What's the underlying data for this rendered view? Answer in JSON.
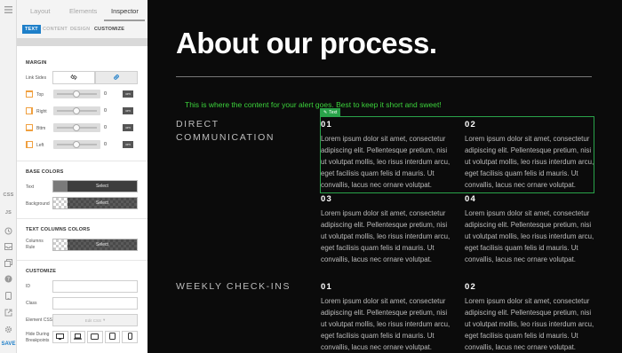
{
  "panel": {
    "tabs": [
      "Layout",
      "Elements",
      "Inspector"
    ],
    "subtabs": [
      "TEXT",
      "CONTENT",
      "DESIGN",
      "CUSTOMIZE"
    ],
    "margin": {
      "title": "MARGIN",
      "link_sides_label": "Link Sides",
      "sides": [
        {
          "label": "Top",
          "value": "0",
          "unit": "cm"
        },
        {
          "label": "Right",
          "value": "0",
          "unit": "cm"
        },
        {
          "label": "Bttm",
          "value": "0",
          "unit": "cm"
        },
        {
          "label": "Left",
          "value": "0",
          "unit": "cm"
        }
      ]
    },
    "base_colors": {
      "title": "BASE COLORS",
      "text_label": "Text",
      "background_label": "Background",
      "select_label": "Select"
    },
    "text_columns_colors": {
      "title": "TEXT COLUMNS COLORS",
      "columns_rule_label": "Columns Rule",
      "select_label": "Select"
    },
    "customize": {
      "title": "CUSTOMIZE",
      "id_label": "ID",
      "class_label": "Class",
      "element_css_label": "Element CSS",
      "element_css_button": "Edit CSS",
      "hide_label": "Hide During Breakpoints"
    }
  },
  "rail": {
    "css_label": "CSS",
    "js_label": "JS",
    "save_label": "SAVE"
  },
  "canvas": {
    "heading": "About our process.",
    "alert": "This is where the content for your alert goes. Best to keep it short and sweet!",
    "selection_tag": "Text",
    "rows": [
      {
        "title": "DIRECT COMMUNICATION",
        "items": [
          {
            "number": "01",
            "text": "Lorem ipsum dolor sit amet, consectetur adipiscing elit. Pellentesque pretium, nisi ut volutpat mollis, leo risus interdum arcu, eget facilisis quam felis id mauris. Ut convallis, lacus nec ornare volutpat."
          },
          {
            "number": "02",
            "text": "Lorem ipsum dolor sit amet, consectetur adipiscing elit. Pellentesque pretium, nisi ut volutpat mollis, leo risus interdum arcu, eget facilisis quam felis id mauris. Ut convallis, lacus nec ornare volutpat."
          },
          {
            "number": "03",
            "text": "Lorem ipsum dolor sit amet, consectetur adipiscing elit. Pellentesque pretium, nisi ut volutpat mollis, leo risus interdum arcu, eget facilisis quam felis id mauris. Ut convallis, lacus nec ornare volutpat."
          },
          {
            "number": "04",
            "text": "Lorem ipsum dolor sit amet, consectetur adipiscing elit. Pellentesque pretium, nisi ut volutpat mollis, leo risus interdum arcu, eget facilisis quam felis id mauris. Ut convallis, lacus nec ornare volutpat."
          }
        ]
      },
      {
        "title": "WEEKLY CHECK-INS",
        "items": [
          {
            "number": "01",
            "text": "Lorem ipsum dolor sit amet, consectetur adipiscing elit. Pellentesque pretium, nisi ut volutpat mollis, leo risus interdum arcu, eget facilisis quam felis id mauris. Ut convallis, lacus nec ornare volutpat."
          },
          {
            "number": "02",
            "text": "Lorem ipsum dolor sit amet, consectetur adipiscing elit. Pellentesque pretium, nisi ut volutpat mollis, leo risus interdum arcu, eget facilisis quam felis id mauris. Ut convallis, lacus nec ornare volutpat."
          }
        ]
      }
    ]
  },
  "colors": {
    "accent": "#1e7fc9",
    "alert": "#3bd23b",
    "selection": "#29a34a",
    "canvas_bg": "#0b0b0b"
  }
}
